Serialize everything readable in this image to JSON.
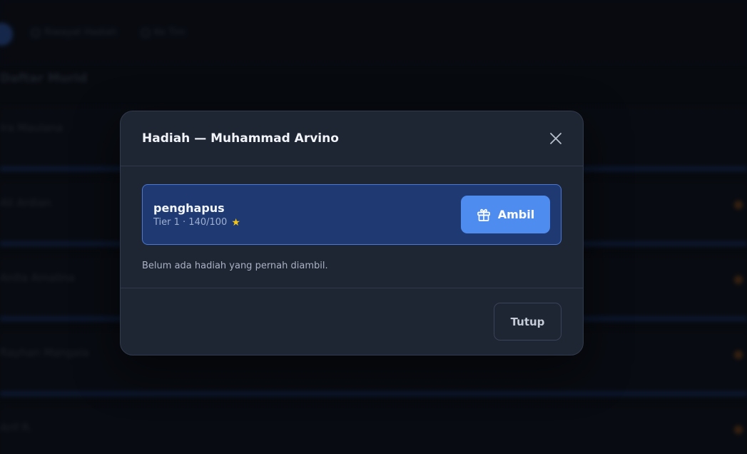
{
  "background": {
    "nav": [
      {
        "icon": "history-icon",
        "label": "Riwayat Hadiah"
      },
      {
        "icon": "back-icon",
        "label": "Ke Tim"
      }
    ],
    "heading": "Daftar Murid",
    "rows": [
      {
        "name": "Ira Maulana"
      },
      {
        "name": "Ali Ardian"
      },
      {
        "name": "Anita Amalina"
      },
      {
        "name": "Rayhan Mangala"
      },
      {
        "name": "Arif R."
      }
    ]
  },
  "modal": {
    "title": "Hadiah — Muhammad Arvino",
    "close_icon": "close-icon",
    "reward": {
      "name": "penghapus",
      "meta": "Tier 1 · 140/100",
      "star": "★",
      "claim_label": "Ambil",
      "claim_icon": "gift-icon"
    },
    "history_note": "Belum ada hadiah yang pernah diambil.",
    "footer_close_label": "Tutup"
  },
  "colors": {
    "accent": "#4f8cf0",
    "card_bg": "#1f3a73",
    "modal_bg": "#1e2533",
    "star": "#f5c518"
  }
}
